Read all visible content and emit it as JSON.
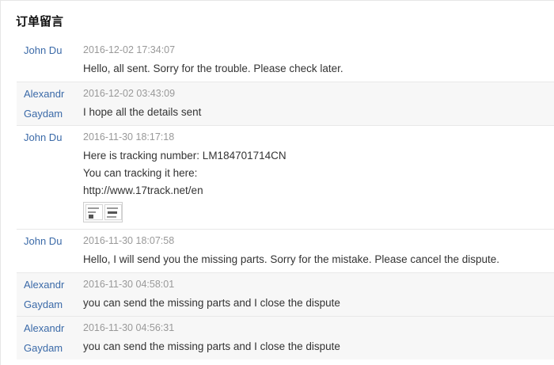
{
  "section_title": "订单留言",
  "messages": [
    {
      "author": [
        "John Du"
      ],
      "time": "2016-12-02 17:34:07",
      "lines": [
        "Hello, all sent. Sorry for the trouble. Please check later."
      ],
      "has_image": false
    },
    {
      "author": [
        "Alexandr",
        "Gaydam"
      ],
      "time": "2016-12-02 03:43:09",
      "lines": [
        "I hope all the details sent"
      ],
      "has_image": false
    },
    {
      "author": [
        "John Du"
      ],
      "time": "2016-11-30 18:17:18",
      "lines": [
        "Here is tracking number: LM184701714CN",
        "You can tracking it here:",
        "http://www.17track.net/en"
      ],
      "has_image": true
    },
    {
      "author": [
        "John Du"
      ],
      "time": "2016-11-30 18:07:58",
      "lines": [
        "Hello, I will send you the missing parts. Sorry for the mistake. Please cancel the dispute."
      ],
      "has_image": false
    },
    {
      "author": [
        "Alexandr",
        "Gaydam"
      ],
      "time": "2016-11-30 04:58:01",
      "lines": [
        "you can send the missing parts and I close the dispute"
      ],
      "has_image": false
    },
    {
      "author": [
        "Alexandr",
        "Gaydam"
      ],
      "time": "2016-11-30 04:56:31",
      "lines": [
        "you can send the missing parts and I close the dispute"
      ],
      "has_image": false
    }
  ]
}
